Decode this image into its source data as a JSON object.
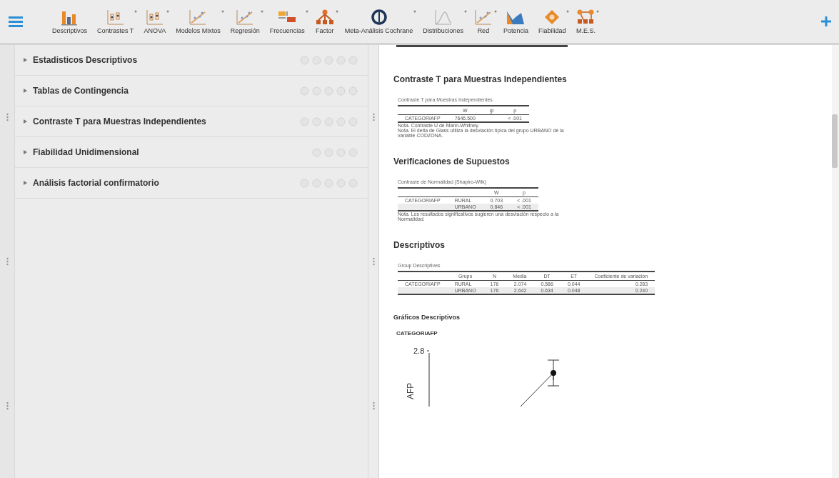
{
  "toolbar": {
    "modules": [
      {
        "label": "Descriptivos",
        "kind": "bars",
        "menu": false
      },
      {
        "label": "Contrastes T",
        "kind": "boxes",
        "menu": true
      },
      {
        "label": "ANOVA",
        "kind": "boxes",
        "menu": true
      },
      {
        "label": "Modelos Mixtos",
        "kind": "scatter",
        "menu": true
      },
      {
        "label": "Regresión",
        "kind": "scatter",
        "menu": true
      },
      {
        "label": "Frecuencias",
        "kind": "blocks",
        "menu": true
      },
      {
        "label": "Factor",
        "kind": "tree",
        "menu": true
      },
      {
        "label": "Meta-Análisis Cochrane",
        "kind": "ring",
        "menu": true
      },
      {
        "label": "Distribuciones",
        "kind": "curve",
        "menu": true
      },
      {
        "label": "Red",
        "kind": "scatter",
        "menu": true
      },
      {
        "label": "Potencia",
        "kind": "area",
        "menu": false
      },
      {
        "label": "Fiabilidad",
        "kind": "diamond",
        "menu": true
      },
      {
        "label": "M.E.S.",
        "kind": "network",
        "menu": true
      }
    ]
  },
  "analyses": [
    {
      "title": "Estadisticos Descriptivos",
      "actions": [
        {
          "kind": "circle"
        },
        {
          "kind": "circle"
        },
        {
          "kind": "circle"
        },
        {
          "kind": "circle"
        },
        {
          "kind": "circle"
        }
      ]
    },
    {
      "title": "Tablas de Contingencia",
      "actions": [
        {
          "kind": "circle"
        },
        {
          "kind": "circle"
        },
        {
          "kind": "circle"
        },
        {
          "kind": "circle"
        },
        {
          "kind": "circle"
        }
      ]
    },
    {
      "title": "Contraste T para Muestras Independientes",
      "actions": [
        {
          "kind": "circle"
        },
        {
          "kind": "circle"
        },
        {
          "kind": "circle"
        },
        {
          "kind": "circle"
        },
        {
          "kind": "circle"
        }
      ]
    },
    {
      "title": "Fiabilidad Unidimensional",
      "actions": [
        {
          "kind": "circle"
        },
        {
          "kind": "circle"
        },
        {
          "kind": "circle"
        },
        {
          "kind": "circle"
        }
      ]
    },
    {
      "title": "Análisis factorial confirmatorio",
      "actions": [
        {
          "kind": "circle"
        },
        {
          "kind": "circle"
        },
        {
          "kind": "circle"
        },
        {
          "kind": "circle"
        },
        {
          "kind": "circle"
        }
      ]
    }
  ],
  "results": [
    {
      "heading": "Contraste T para Muestras Independientes",
      "table": {
        "caption": "Contraste T para Muestras Independientes",
        "columns": [
          "",
          "W",
          "gl",
          "p"
        ],
        "rows": [
          [
            "CATEGORIAFP",
            "7646.500",
            "",
            "< .001"
          ]
        ],
        "notes": [
          "Nota. Contraste U de Mann-Whitney.",
          "Nota. El delta de Glass utiliza la desviación típica del grupo URBANO de la variable CODZONA."
        ]
      }
    },
    {
      "heading": "Verificaciones de Supuestos",
      "table": {
        "caption": "Contraste de Normalidad (Shapiro-Wilk)",
        "columns": [
          "",
          "",
          "W",
          "p"
        ],
        "rows": [
          [
            "CATEGORIAFP",
            "RURAL",
            "0.703",
            "< .001"
          ],
          [
            "",
            "URBANO",
            "0.846",
            "< .001"
          ]
        ],
        "notes": [
          "Nota. Los resultados significativos sugieren una desviación respecto a la Normalidad."
        ]
      }
    },
    {
      "heading": "Descriptivos",
      "table": {
        "caption": "Group Descriptives",
        "columns": [
          "",
          "Grupo",
          "N",
          "Media",
          "DT",
          "ET",
          "Coeficiente de variación"
        ],
        "rows": [
          [
            "CATEGORIAFP",
            "RURAL",
            "176",
            "2.074",
            "0.586",
            "0.044",
            "0.283"
          ],
          [
            "",
            "URBANO",
            "176",
            "2.642",
            "0.634",
            "0.048",
            "0.240"
          ]
        ]
      }
    }
  ],
  "plots": {
    "heading": "Gráficos Descriptivos",
    "title": "CATEGORIAFP",
    "ytick": "2.8",
    "ylabel": "AFP"
  }
}
